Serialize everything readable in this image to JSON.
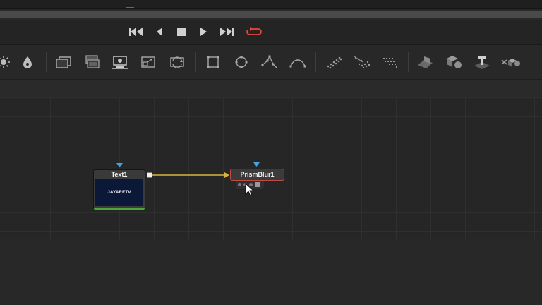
{
  "transport": {
    "buttons": [
      {
        "name": "go-to-start-icon"
      },
      {
        "name": "play-reverse-icon"
      },
      {
        "name": "stop-icon"
      },
      {
        "name": "play-forward-icon"
      },
      {
        "name": "go-to-end-icon"
      },
      {
        "name": "loop-icon",
        "color": "#e8463a"
      }
    ]
  },
  "toolbar": {
    "tools": [
      "brightness-icon",
      "blur-drop-icon",
      "background-icon",
      "merge-icon",
      "media-in-icon",
      "resize-icon",
      "transform-icon",
      "rectangle-mask-icon",
      "ellipse-mask-icon",
      "polygon-mask-icon",
      "bspline-mask-icon",
      "particle-emitter-icon",
      "particle-render-icon",
      "particle-merge-icon",
      "image-plane-3d-icon",
      "shape-3d-icon",
      "text-3d-icon",
      "renderer-3d-icon"
    ]
  },
  "nodes": {
    "text1": {
      "title": "Text1",
      "thumbnail_text": "JAYARETV",
      "accent": "#4fa53c"
    },
    "prism_blur1": {
      "title": "PrismBlur1",
      "selected_border": "#c24a45"
    }
  },
  "colors": {
    "connection": "#d8b440",
    "input_arrow": "#3fa4e8",
    "loop_red": "#e8463a"
  }
}
